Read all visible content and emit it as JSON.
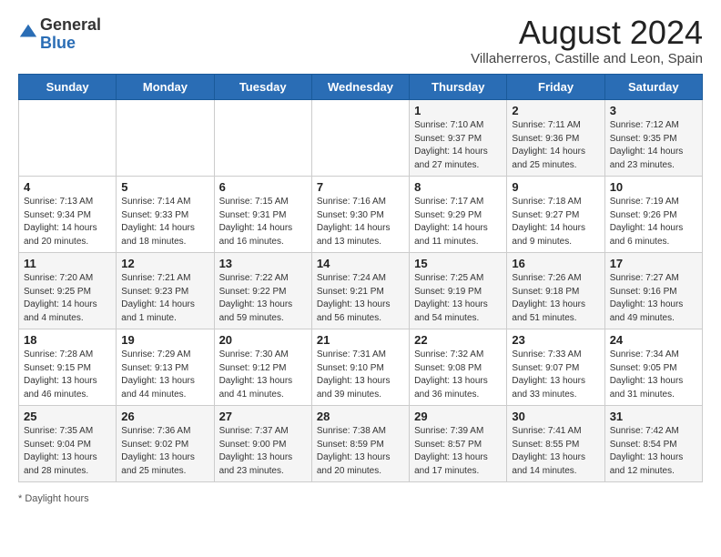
{
  "header": {
    "logo_general": "General",
    "logo_blue": "Blue",
    "month_year": "August 2024",
    "location": "Villaherreros, Castille and Leon, Spain"
  },
  "days_of_week": [
    "Sunday",
    "Monday",
    "Tuesday",
    "Wednesday",
    "Thursday",
    "Friday",
    "Saturday"
  ],
  "weeks": [
    [
      {
        "day": "",
        "info": ""
      },
      {
        "day": "",
        "info": ""
      },
      {
        "day": "",
        "info": ""
      },
      {
        "day": "",
        "info": ""
      },
      {
        "day": "1",
        "info": "Sunrise: 7:10 AM\nSunset: 9:37 PM\nDaylight: 14 hours\nand 27 minutes."
      },
      {
        "day": "2",
        "info": "Sunrise: 7:11 AM\nSunset: 9:36 PM\nDaylight: 14 hours\nand 25 minutes."
      },
      {
        "day": "3",
        "info": "Sunrise: 7:12 AM\nSunset: 9:35 PM\nDaylight: 14 hours\nand 23 minutes."
      }
    ],
    [
      {
        "day": "4",
        "info": "Sunrise: 7:13 AM\nSunset: 9:34 PM\nDaylight: 14 hours\nand 20 minutes."
      },
      {
        "day": "5",
        "info": "Sunrise: 7:14 AM\nSunset: 9:33 PM\nDaylight: 14 hours\nand 18 minutes."
      },
      {
        "day": "6",
        "info": "Sunrise: 7:15 AM\nSunset: 9:31 PM\nDaylight: 14 hours\nand 16 minutes."
      },
      {
        "day": "7",
        "info": "Sunrise: 7:16 AM\nSunset: 9:30 PM\nDaylight: 14 hours\nand 13 minutes."
      },
      {
        "day": "8",
        "info": "Sunrise: 7:17 AM\nSunset: 9:29 PM\nDaylight: 14 hours\nand 11 minutes."
      },
      {
        "day": "9",
        "info": "Sunrise: 7:18 AM\nSunset: 9:27 PM\nDaylight: 14 hours\nand 9 minutes."
      },
      {
        "day": "10",
        "info": "Sunrise: 7:19 AM\nSunset: 9:26 PM\nDaylight: 14 hours\nand 6 minutes."
      }
    ],
    [
      {
        "day": "11",
        "info": "Sunrise: 7:20 AM\nSunset: 9:25 PM\nDaylight: 14 hours\nand 4 minutes."
      },
      {
        "day": "12",
        "info": "Sunrise: 7:21 AM\nSunset: 9:23 PM\nDaylight: 14 hours\nand 1 minute."
      },
      {
        "day": "13",
        "info": "Sunrise: 7:22 AM\nSunset: 9:22 PM\nDaylight: 13 hours\nand 59 minutes."
      },
      {
        "day": "14",
        "info": "Sunrise: 7:24 AM\nSunset: 9:21 PM\nDaylight: 13 hours\nand 56 minutes."
      },
      {
        "day": "15",
        "info": "Sunrise: 7:25 AM\nSunset: 9:19 PM\nDaylight: 13 hours\nand 54 minutes."
      },
      {
        "day": "16",
        "info": "Sunrise: 7:26 AM\nSunset: 9:18 PM\nDaylight: 13 hours\nand 51 minutes."
      },
      {
        "day": "17",
        "info": "Sunrise: 7:27 AM\nSunset: 9:16 PM\nDaylight: 13 hours\nand 49 minutes."
      }
    ],
    [
      {
        "day": "18",
        "info": "Sunrise: 7:28 AM\nSunset: 9:15 PM\nDaylight: 13 hours\nand 46 minutes."
      },
      {
        "day": "19",
        "info": "Sunrise: 7:29 AM\nSunset: 9:13 PM\nDaylight: 13 hours\nand 44 minutes."
      },
      {
        "day": "20",
        "info": "Sunrise: 7:30 AM\nSunset: 9:12 PM\nDaylight: 13 hours\nand 41 minutes."
      },
      {
        "day": "21",
        "info": "Sunrise: 7:31 AM\nSunset: 9:10 PM\nDaylight: 13 hours\nand 39 minutes."
      },
      {
        "day": "22",
        "info": "Sunrise: 7:32 AM\nSunset: 9:08 PM\nDaylight: 13 hours\nand 36 minutes."
      },
      {
        "day": "23",
        "info": "Sunrise: 7:33 AM\nSunset: 9:07 PM\nDaylight: 13 hours\nand 33 minutes."
      },
      {
        "day": "24",
        "info": "Sunrise: 7:34 AM\nSunset: 9:05 PM\nDaylight: 13 hours\nand 31 minutes."
      }
    ],
    [
      {
        "day": "25",
        "info": "Sunrise: 7:35 AM\nSunset: 9:04 PM\nDaylight: 13 hours\nand 28 minutes."
      },
      {
        "day": "26",
        "info": "Sunrise: 7:36 AM\nSunset: 9:02 PM\nDaylight: 13 hours\nand 25 minutes."
      },
      {
        "day": "27",
        "info": "Sunrise: 7:37 AM\nSunset: 9:00 PM\nDaylight: 13 hours\nand 23 minutes."
      },
      {
        "day": "28",
        "info": "Sunrise: 7:38 AM\nSunset: 8:59 PM\nDaylight: 13 hours\nand 20 minutes."
      },
      {
        "day": "29",
        "info": "Sunrise: 7:39 AM\nSunset: 8:57 PM\nDaylight: 13 hours\nand 17 minutes."
      },
      {
        "day": "30",
        "info": "Sunrise: 7:41 AM\nSunset: 8:55 PM\nDaylight: 13 hours\nand 14 minutes."
      },
      {
        "day": "31",
        "info": "Sunrise: 7:42 AM\nSunset: 8:54 PM\nDaylight: 13 hours\nand 12 minutes."
      }
    ]
  ],
  "footer": {
    "note": "Daylight hours"
  }
}
